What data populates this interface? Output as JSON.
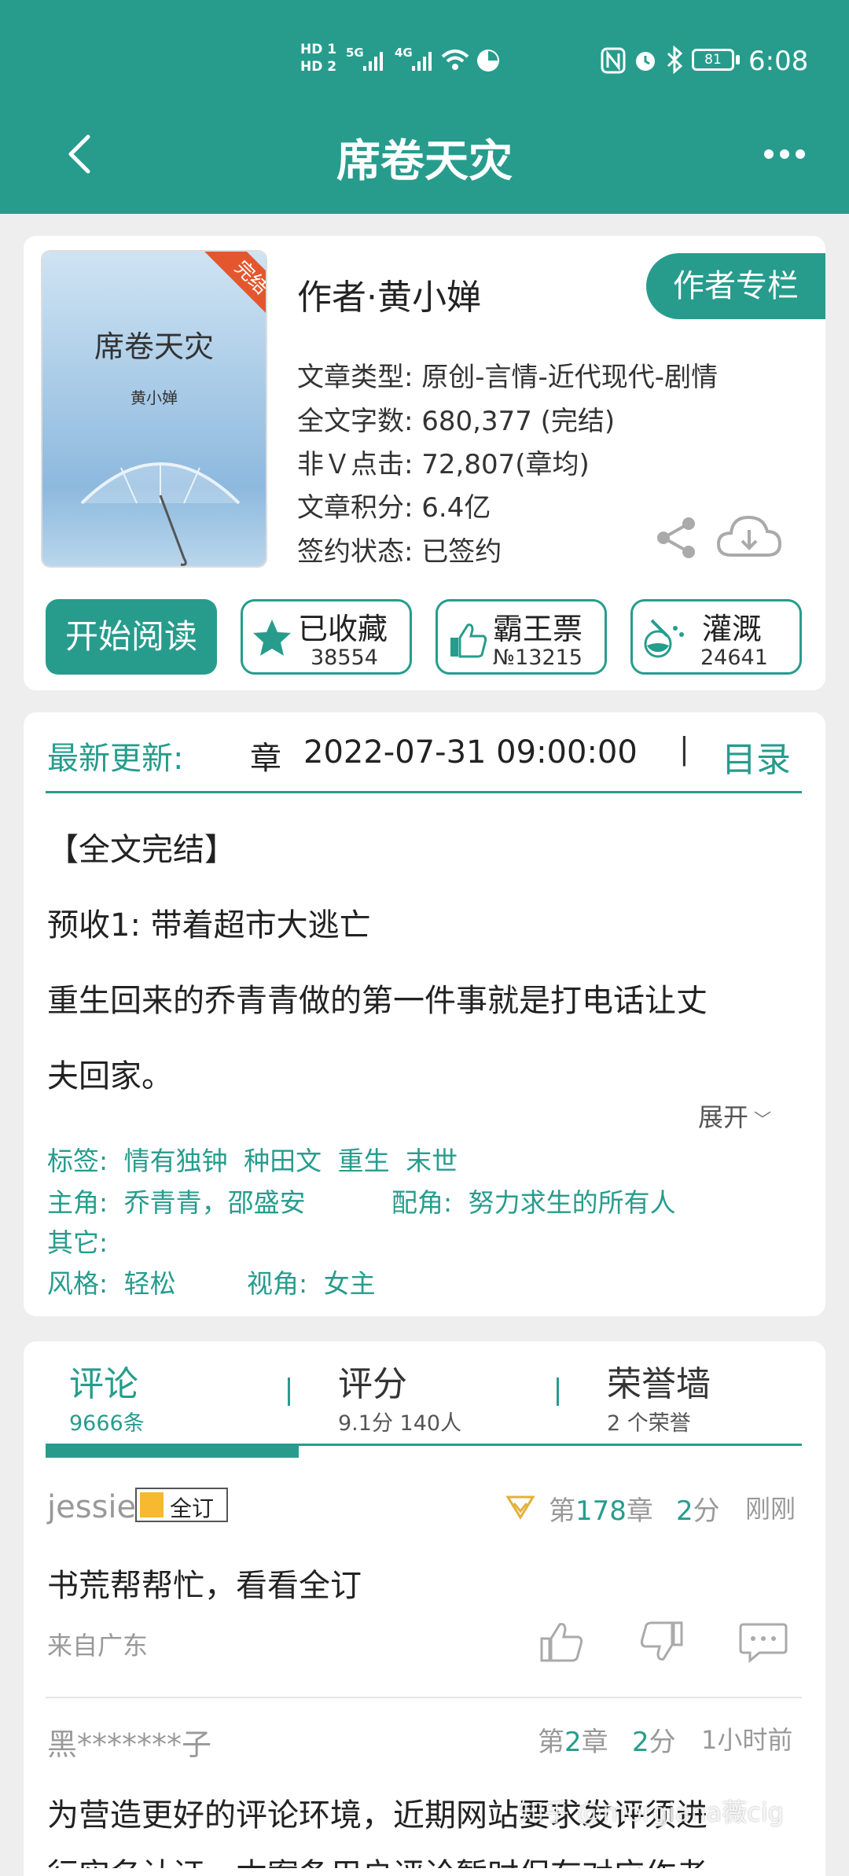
{
  "status": {
    "sim1": "HD 1",
    "sim2": "HD 2",
    "net1": "5G",
    "net2": "4G",
    "battery": "81",
    "time": "6:08"
  },
  "header": {
    "title": "席卷天灾"
  },
  "book": {
    "cover_title": "席卷天灾",
    "cover_author": "黄小婵",
    "cover_badge": "完结",
    "author_line": "作者·黄小婵",
    "author_column_btn": "作者专栏",
    "type": "文章类型: 原创-言情-近代现代-剧情",
    "words": "全文字数: 680,377 (完结)",
    "clicks": "非Ｖ点击: 72,807(章均)",
    "score": "文章积分: 6.4亿",
    "sign": "签约状态:  已签约"
  },
  "actions": {
    "read": "开始阅读",
    "fav_label": "已收藏",
    "fav_count": "38554",
    "ticket_label": "霸王票",
    "ticket_count": "№13215",
    "water_label": "灌溉",
    "water_count": "24641"
  },
  "latest": {
    "label": "最新更新:",
    "chapter": "章",
    "datetime": "2022-07-31 09:00:00",
    "sep": "|",
    "toc": "目录"
  },
  "intro": {
    "line1": "【全文完结】",
    "line2": "预收1:  带着超市大逃亡",
    "line3": "重生回来的乔青青做的第一件事就是打电话让丈",
    "line4": "夫回家。",
    "expand": "展开"
  },
  "tags": {
    "tags_label": "标签:",
    "tags": [
      "情有独钟",
      "种田文",
      "重生",
      "末世"
    ],
    "lead_label": "主角:",
    "lead": "乔青青，邵盛安",
    "support_label": "配角:",
    "support": "努力求生的所有人",
    "other_label": "其它:",
    "style_label": "风格:",
    "style": "轻松",
    "view_label": "视角:",
    "view": "女主"
  },
  "tabs": [
    {
      "label": "评论",
      "sub": "9666条"
    },
    {
      "label": "评分",
      "sub": "9.1分 140人"
    },
    {
      "label": "荣誉墙",
      "sub": "2 个荣誉"
    }
  ],
  "comments": [
    {
      "user": "jessie",
      "badge": "全订",
      "chapter_pre": "第",
      "chapter_num": "178",
      "chapter_post": "章",
      "score_num": "2",
      "score_unit": "分",
      "time": "刚刚",
      "text": "书荒帮帮忙，看看全订",
      "from": "来自广东"
    },
    {
      "user": "黑*******子",
      "chapter_pre": "第",
      "chapter_num": "2",
      "chapter_post": "章",
      "score_num": "2",
      "score_unit": "分",
      "time": "1小时前",
      "text": "为营造更好的评论环境，近期网站要求发评须进",
      "text2": "行实名认证，本案条用户评论暂时保存对应作者"
    }
  ],
  "watermark": "知乎 @morgiana薇cig",
  "colors": {
    "primary": "#279c8d",
    "background": "#eeeeee",
    "card": "#ffffff",
    "muted": "#999999"
  }
}
